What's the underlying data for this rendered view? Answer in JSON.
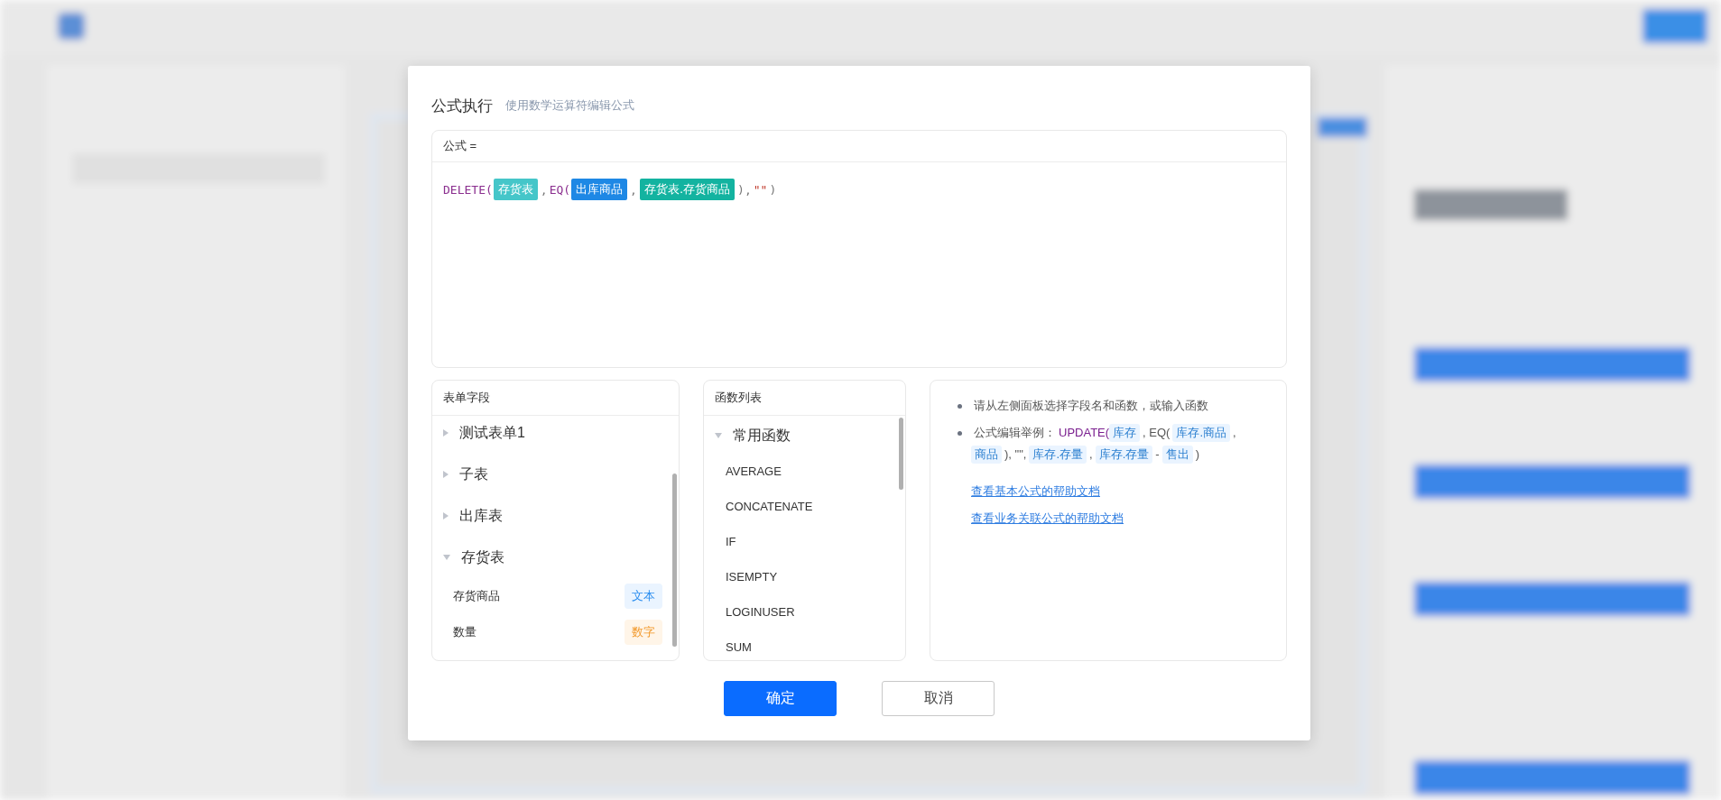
{
  "dialog": {
    "title": "公式执行",
    "subtitle": "使用数学运算符编辑公式"
  },
  "formula": {
    "label": "公式 =",
    "tokens": [
      {
        "kind": "keyword",
        "text": "DELETE("
      },
      {
        "kind": "tag",
        "text": "存货表",
        "color": "#45c6c9"
      },
      {
        "kind": "punct",
        "text": ","
      },
      {
        "kind": "keyword",
        "text": "EQ("
      },
      {
        "kind": "tag",
        "text": "出库商品",
        "color": "#1e88e5"
      },
      {
        "kind": "punct",
        "text": ","
      },
      {
        "kind": "tag",
        "text": "存货表.存货商品",
        "color": "#13b3a0"
      },
      {
        "kind": "punct",
        "text": "),"
      },
      {
        "kind": "string",
        "text": "\"\""
      },
      {
        "kind": "punct",
        "text": ")"
      }
    ]
  },
  "fields": {
    "title": "表单字段",
    "groups": [
      {
        "label": "测试表单1",
        "expanded": false
      },
      {
        "label": "子表",
        "expanded": false
      },
      {
        "label": "出库表",
        "expanded": false
      },
      {
        "label": "存货表",
        "expanded": true,
        "children": [
          {
            "label": "存货商品",
            "type": {
              "kind": "text",
              "label": "文本"
            }
          },
          {
            "label": "数量",
            "type": {
              "kind": "number",
              "label": "数字"
            }
          }
        ]
      }
    ]
  },
  "functions": {
    "title": "函数列表",
    "groups": [
      {
        "label": "常用函数",
        "expanded": true,
        "children": [
          "AVERAGE",
          "CONCATENATE",
          "IF",
          "ISEMPTY",
          "LOGINUSER",
          "SUM"
        ]
      }
    ]
  },
  "help": {
    "bullets": [
      [
        {
          "kind": "plain",
          "text": "请从左侧面板选择字段名和函数，或输入函数"
        }
      ],
      [
        {
          "kind": "plain",
          "text": "公式编辑举例："
        },
        {
          "kind": "keyword",
          "text": "UPDATE("
        },
        {
          "kind": "tag",
          "text": "库存"
        },
        {
          "kind": "plain",
          "text": ", EQ("
        },
        {
          "kind": "tag",
          "text": "库存.商品"
        },
        {
          "kind": "plain",
          "text": ","
        },
        {
          "kind": "tag",
          "text": "商品"
        },
        {
          "kind": "plain",
          "text": "), \"\","
        },
        {
          "kind": "tag",
          "text": "库存.存量"
        },
        {
          "kind": "plain",
          "text": ","
        },
        {
          "kind": "tag",
          "text": "库存.存量"
        },
        {
          "kind": "plain",
          "text": "-"
        },
        {
          "kind": "tag",
          "text": "售出"
        },
        {
          "kind": "plain",
          "text": ")"
        }
      ]
    ],
    "links": [
      "查看基本公式的帮助文档",
      "查看业务关联公式的帮助文档"
    ]
  },
  "buttons": [
    {
      "kind": "primary",
      "label": "确定"
    },
    {
      "kind": "default",
      "label": "取消"
    }
  ]
}
